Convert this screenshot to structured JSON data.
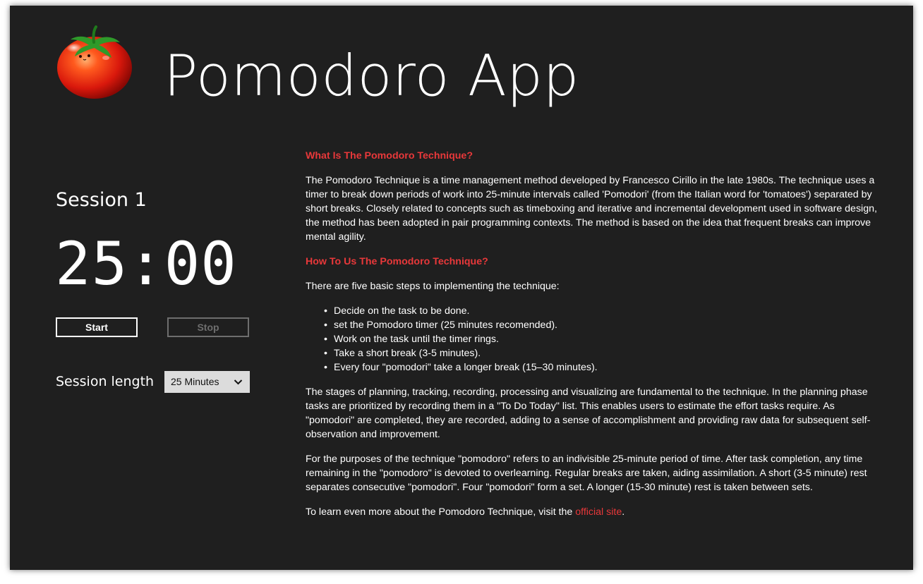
{
  "header": {
    "title": "Pomodoro App",
    "logo_icon": "tomato-icon"
  },
  "timer_panel": {
    "session_title": "Session 1",
    "time_display": "25:00",
    "start_label": "Start",
    "stop_label": "Stop",
    "session_length_label": "Session length",
    "session_length_value": "25 Minutes"
  },
  "article": {
    "heading_1": "What Is The Pomodoro Technique?",
    "para_1": "The Pomodoro Technique is a time management method developed by Francesco Cirillo in the late 1980s. The technique uses a timer to break down periods of work into 25-minute intervals called 'Pomodori' (from the Italian word for 'tomatoes') separated by short breaks. Closely related to concepts such as timeboxing and iterative and incremental development used in software design, the method has been adopted in pair programming contexts. The method is based on the idea that frequent breaks can improve mental agility.",
    "heading_2": "How To Us The Pomodoro Technique?",
    "para_2": "There are five basic steps to implementing the technique:",
    "steps": [
      "Decide on the task to be done.",
      "set the Pomodoro timer (25 minutes recomended).",
      "Work on the task until the timer rings.",
      "Take a short break (3-5 minutes).",
      "Every four \"pomodori\" take a longer break (15–30 minutes)."
    ],
    "para_3": "The stages of planning, tracking, recording, processing and visualizing are fundamental to the technique. In the planning phase tasks are prioritized by recording them in a \"To Do Today\" list. This enables users to estimate the effort tasks require. As \"pomodori\" are completed, they are recorded, adding to a sense of accomplishment and providing raw data for subsequent self-observation and improvement.",
    "para_4": "For the purposes of the technique \"pomodoro\" refers to an indivisible 25-minute period of time. After task completion, any time remaining in the \"pomodoro\" is devoted to overlearning. Regular breaks are taken, aiding assimilation. A short (3-5 minute) rest separates consecutive \"pomodori\". Four \"pomodori\" form a set. A longer (15-30 minute) rest is taken between sets.",
    "para_5_prefix": "To learn even more about the Pomodoro Technique, visit the ",
    "para_5_link": "official site",
    "para_5_suffix": "."
  },
  "colors": {
    "background": "#1f1f1f",
    "accent": "#e8383a",
    "text": "#ffffff",
    "disabled": "#6e6e6e"
  }
}
